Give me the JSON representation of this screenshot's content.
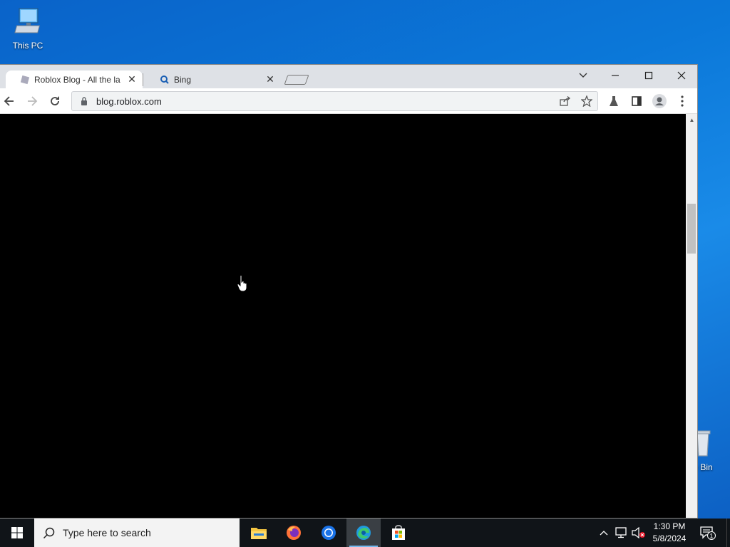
{
  "desktop": {
    "icons": [
      {
        "label": "This PC"
      },
      {
        "label": "e Bin"
      }
    ]
  },
  "browser": {
    "tabs": [
      {
        "title": "Roblox Blog - All the la",
        "active": true
      },
      {
        "title": "Bing",
        "active": false
      }
    ],
    "url": "blog.roblox.com"
  },
  "taskbar": {
    "search_placeholder": "Type here to search",
    "clock_time": "1:30 PM",
    "clock_date": "5/8/2024",
    "notification_count": "1"
  }
}
